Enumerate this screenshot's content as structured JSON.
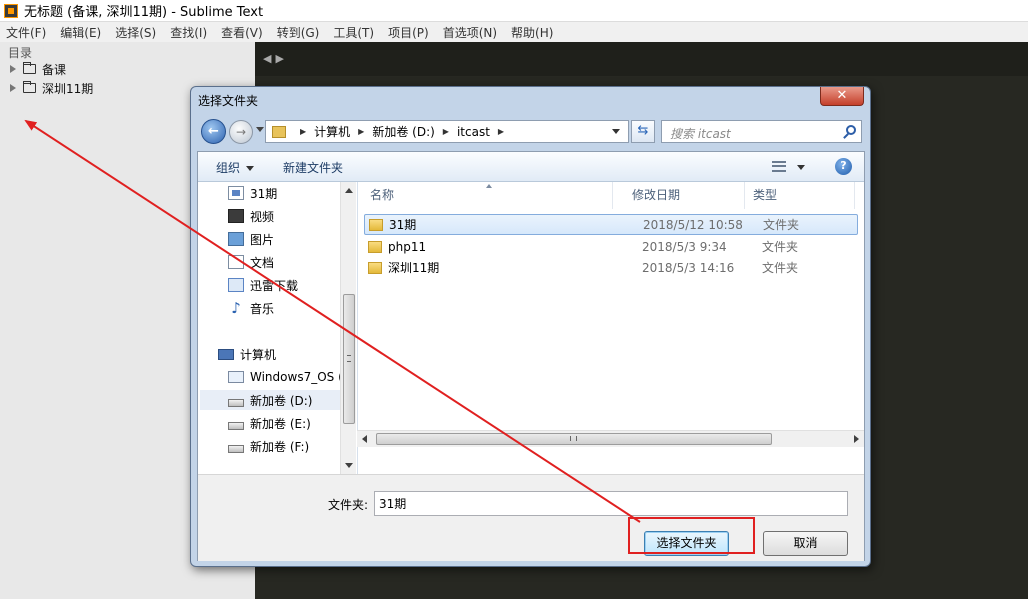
{
  "window": {
    "title": "无标题 (备课, 深圳11期) - Sublime Text",
    "menu": [
      "文件(F)",
      "编辑(E)",
      "选择(S)",
      "查找(I)",
      "查看(V)",
      "转到(G)",
      "工具(T)",
      "项目(P)",
      "首选项(N)",
      "帮助(H)"
    ]
  },
  "sidebar": {
    "heading": "目录",
    "folders": [
      "备课",
      "深圳11期"
    ]
  },
  "dialog": {
    "title": "选择文件夹",
    "close_label": "✕",
    "address": {
      "crumbs": [
        "计算机",
        "新加卷 (D:)",
        "itcast"
      ]
    },
    "search": {
      "placeholder": "搜索 itcast"
    },
    "toolbar": {
      "organize": "组织",
      "new_folder": "新建文件夹",
      "help": "?"
    },
    "nav": {
      "items": [
        "31期",
        "视频",
        "图片",
        "文档",
        "迅雷下载",
        "音乐"
      ],
      "computer": "计算机",
      "drives": [
        "Windows7_OS (",
        "新加卷 (D:)",
        "新加卷 (E:)",
        "新加卷 (F:)"
      ]
    },
    "columns": {
      "name": "名称",
      "date": "修改日期",
      "type": "类型"
    },
    "files": [
      {
        "name": "31期",
        "date": "2018/5/12 10:58",
        "type": "文件夹"
      },
      {
        "name": "php11",
        "date": "2018/5/3 9:34",
        "type": "文件夹"
      },
      {
        "name": "深圳11期",
        "date": "2018/5/3 14:16",
        "type": "文件夹"
      }
    ],
    "folder_label": "文件夹:",
    "folder_value": "31期",
    "select_button": "选择文件夹",
    "cancel_button": "取消"
  },
  "annotation": {
    "color": "#e02020"
  }
}
